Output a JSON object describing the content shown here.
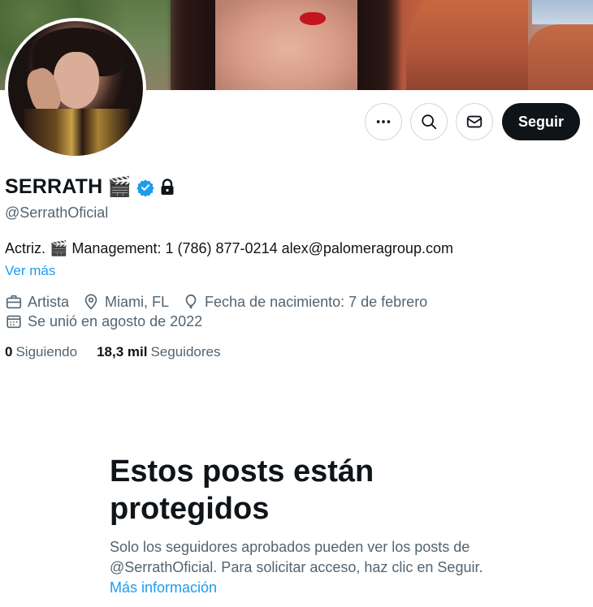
{
  "profile": {
    "name": "SERRATH",
    "name_emoji": "🎬",
    "handle": "@SerrathOficial",
    "bio": "Actriz. 🎬 Management: 1 (786) 877-0214 alex@palomeragroup.com",
    "see_more": "Ver más",
    "verified_color": "#1d9bf0"
  },
  "actions": {
    "more_icon": "more-icon",
    "search_icon": "search-icon",
    "message_icon": "mail-icon",
    "follow_label": "Seguir"
  },
  "meta": {
    "category": "Artista",
    "location": "Miami, FL",
    "birthday": "Fecha de nacimiento: 7 de febrero",
    "joined": "Se unió en agosto de 2022"
  },
  "stats": {
    "following_count": "0",
    "following_label": "Siguiendo",
    "followers_count": "18,3 mil",
    "followers_label": "Seguidores"
  },
  "protected": {
    "title": "Estos posts están protegidos",
    "text": "Solo los seguidores aprobados pueden ver los posts de @SerrathOficial. Para solicitar acceso, haz clic en Seguir.",
    "link": "Más información"
  },
  "colors": {
    "accent": "#1d9bf0",
    "text": "#0f1419",
    "secondary": "#536471",
    "border": "#cfd9de"
  }
}
